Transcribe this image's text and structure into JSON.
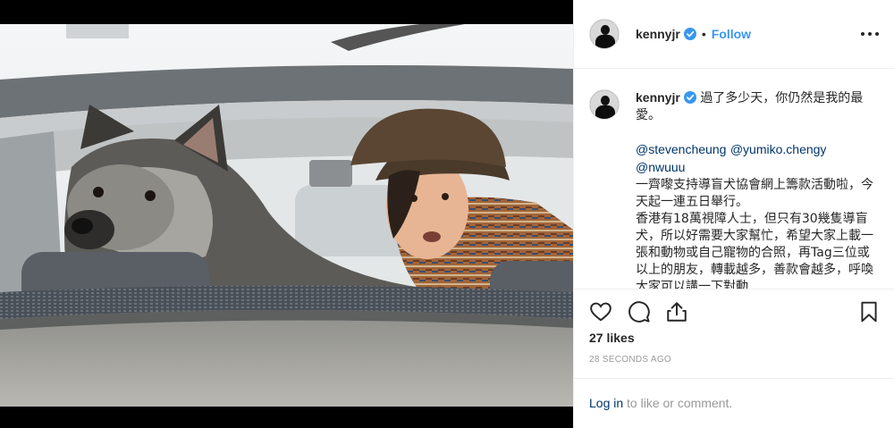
{
  "post": {
    "username": "kennyjr",
    "dot": "•",
    "follow_label": "Follow",
    "caption_user": "kennyjr",
    "caption_line1": "過了多少天，你仍然是我的最愛。",
    "mentions": [
      "@stevencheung",
      "@yumiko.chengy",
      "@nwuuu"
    ],
    "caption_line2": "一齊嚟支持導盲犬協會網上籌款活動啦，今天起一連五日舉行。",
    "caption_line3": "香港有18萬視障人士，但只有30幾隻導盲犬，所以好需要大家幫忙，希望大家上載一張和動物或自己寵物的合照，再Tag三位或以上的朋友，轉載越多，善款會越多，呼喚大家可以講一下對動",
    "likes": "27 likes",
    "timestamp": "28 SECONDS AGO",
    "login_link": "Log in",
    "login_rest": " to like or comment."
  },
  "colors": {
    "accent": "#3897f0",
    "link": "#003569",
    "muted": "#999999",
    "text": "#262626"
  },
  "icons": {
    "verified": "verified-badge-icon",
    "more": "more-options-icon",
    "like": "heart-icon",
    "comment": "comment-bubble-icon",
    "share": "share-icon",
    "save": "bookmark-icon"
  }
}
